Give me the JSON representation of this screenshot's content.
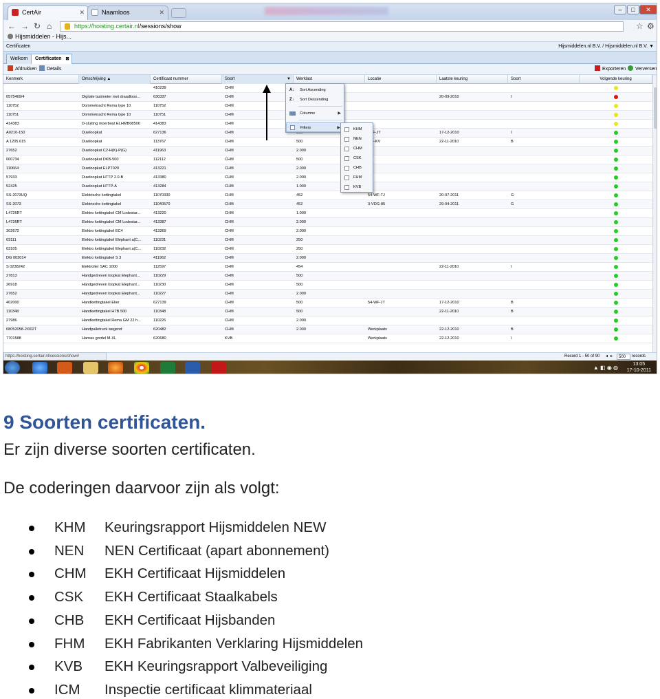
{
  "browser": {
    "tabs": [
      {
        "label": "CertAir"
      },
      {
        "label": "Naamloos"
      }
    ],
    "url_host": "https://hoisting.certair.nl",
    "url_path": "/sessions/show",
    "bookmark": "Hijsmiddelen - Hijs..."
  },
  "app": {
    "section_title": "Certificaten",
    "company": "Hijsmiddelen.nl B.V. / Hijsmiddelen.nl B.V. ▼",
    "tabs": [
      {
        "label": "Welkom"
      },
      {
        "label": "Certificaten"
      }
    ],
    "toolbar": {
      "print": "Afdrukken",
      "details": "Details",
      "export": "Exporteren",
      "refresh": "Verversen"
    }
  },
  "grid": {
    "columns": [
      "Kenmerk",
      "Omschrijving ▲",
      "Certificaat nummer",
      "Soort",
      "Werklast",
      "Locatie",
      "Laatste keuring",
      "Soort",
      "Volgende keuring"
    ],
    "rows": [
      {
        "k": "",
        "o": "",
        "c": "410239",
        "s": "CHM",
        "w": "",
        "l": "",
        "d": "",
        "t": "",
        "st": "yellow"
      },
      {
        "k": "0575469/4",
        "o": "Digitale lastmeter met draadloos...",
        "c": "630337",
        "s": "CHM",
        "w": "",
        "l": "",
        "d": "20-09-2010",
        "t": "I",
        "st": "red"
      },
      {
        "k": "110752",
        "o": "Dommekracht Rema type 10",
        "c": "110752",
        "s": "CHM",
        "w": "",
        "l": "",
        "d": "",
        "t": "",
        "st": "yellow"
      },
      {
        "k": "110751",
        "o": "Dommekracht Rema type 10",
        "c": "110751",
        "s": "CHM",
        "w": "",
        "l": "",
        "d": "",
        "t": "",
        "st": "yellow"
      },
      {
        "k": "414383",
        "o": "D-sluiting moerbout ELHMB08500",
        "c": "414383",
        "s": "CHM",
        "w": "",
        "l": "",
        "d": "",
        "t": "",
        "st": "yellow"
      },
      {
        "k": "A0210-150",
        "o": "Duwloopkat",
        "c": "627136",
        "s": "CHM",
        "w": "500",
        "l": "-WF-JT",
        "d": "17-12-2010",
        "t": "I",
        "st": "green"
      },
      {
        "k": "A 1205.615",
        "o": "Duwloopkat",
        "c": "113767",
        "s": "CHM",
        "w": "500",
        "l": "-BF-KV",
        "d": "22-11-2010",
        "t": "B",
        "st": "green"
      },
      {
        "k": "27652",
        "o": "Duwloopkat C2-H(K)-P(G)",
        "c": "411963",
        "s": "CHM",
        "w": "2.000",
        "l": "",
        "d": "",
        "t": "",
        "st": "green"
      },
      {
        "k": "000734",
        "o": "Duwloopkat DKB-500",
        "c": "112112",
        "s": "CHM",
        "w": "500",
        "l": "",
        "d": "",
        "t": "",
        "st": "green"
      },
      {
        "k": "110664",
        "o": "Duwloopkat ELPT020",
        "c": "413221",
        "s": "CHM",
        "w": "2.000",
        "l": "",
        "d": "",
        "t": "",
        "st": "green"
      },
      {
        "k": "57933",
        "o": "Duwloopkat HTTP 2.0-B",
        "c": "413380",
        "s": "CHM",
        "w": "2.000",
        "l": "",
        "d": "",
        "t": "",
        "st": "green"
      },
      {
        "k": "52425",
        "o": "Duwloopkat HTTP-A",
        "c": "413284",
        "s": "CHM",
        "w": "1.000",
        "l": "",
        "d": "",
        "t": "",
        "st": "green"
      },
      {
        "k": "SS-2073UQ",
        "o": "Elektrische kettingtakel",
        "c": "11070330",
        "s": "CHM",
        "w": "452",
        "l": "54-WF-TJ",
        "d": "20-07-2011",
        "t": "G",
        "st": "green"
      },
      {
        "k": "SS-2073",
        "o": "Elektrische kettingtakel",
        "c": "11040570",
        "s": "CHM",
        "w": "452",
        "l": "3-VDG-85",
        "d": "29-04-2011",
        "t": "G",
        "st": "green"
      },
      {
        "k": "L4726RT",
        "o": "Elektro kettingtakel CM Lodestar...",
        "c": "413220",
        "s": "CHM",
        "w": "1.000",
        "l": "",
        "d": "",
        "t": "",
        "st": "green"
      },
      {
        "k": "L4726RT",
        "o": "Elektro kettingtakel CM Lodestar...",
        "c": "413387",
        "s": "CHM",
        "w": "2.000",
        "l": "",
        "d": "",
        "t": "",
        "st": "green"
      },
      {
        "k": "302672",
        "o": "Elektro kettingtakel EC4",
        "c": "413369",
        "s": "CHM",
        "w": "2.000",
        "l": "",
        "d": "",
        "t": "",
        "st": "green"
      },
      {
        "k": "03111",
        "o": "Elektro kettingtakel Elephant a(C...",
        "c": "110231",
        "s": "CHM",
        "w": "250",
        "l": "",
        "d": "",
        "t": "",
        "st": "green"
      },
      {
        "k": "03105",
        "o": "Elektro kettingtakel Elephant a(C...",
        "c": "110232",
        "s": "CHM",
        "w": "250",
        "l": "",
        "d": "",
        "t": "",
        "st": "green"
      },
      {
        "k": "DG 003014",
        "o": "Elektro kettingtakel S 3",
        "c": "411962",
        "s": "CHM",
        "w": "2.000",
        "l": "",
        "d": "",
        "t": "",
        "st": "green"
      },
      {
        "k": "S 0238242",
        "o": "Elektrolier SAC 1000",
        "c": "112597",
        "s": "CHM",
        "w": "454",
        "l": "",
        "d": "22-11-2010",
        "t": "I",
        "st": "green"
      },
      {
        "k": "27813",
        "o": "Handgedreven loopkat Elephant...",
        "c": "110229",
        "s": "CHM",
        "w": "500",
        "l": "",
        "d": "",
        "t": "",
        "st": "green"
      },
      {
        "k": "26918",
        "o": "Handgedreven loopkat Elephant...",
        "c": "110230",
        "s": "CHM",
        "w": "500",
        "l": "",
        "d": "",
        "t": "",
        "st": "green"
      },
      {
        "k": "27652",
        "o": "Handgedreven loopkat Elephant...",
        "c": "110227",
        "s": "CHM",
        "w": "2.000",
        "l": "",
        "d": "",
        "t": "",
        "st": "green"
      },
      {
        "k": "402000",
        "o": "Handkettingtakel Elier",
        "c": "627139",
        "s": "CHM",
        "w": "500",
        "l": "54-WF-JT",
        "d": "17-12-2010",
        "t": "B",
        "st": "green"
      },
      {
        "k": "110348",
        "o": "Handkettingtakel HTB 500",
        "c": "110348",
        "s": "CHM",
        "w": "500",
        "l": "",
        "d": "22-11-2010",
        "t": "B",
        "st": "green"
      },
      {
        "k": "27986",
        "o": "Handkettingtakel Rema GM 22 h...",
        "c": "110226",
        "s": "CHM",
        "w": "2.000",
        "l": "",
        "d": "",
        "t": "",
        "st": "green"
      },
      {
        "k": "08052058-2/002T",
        "o": "Handpalletruck wegend",
        "c": "620482",
        "s": "CHM",
        "w": "2.000",
        "l": "Werkplaats",
        "d": "22-12-2010",
        "t": "B",
        "st": "green"
      },
      {
        "k": "7701588",
        "o": "Harnas gordel M-XL",
        "c": "620680",
        "s": "KVB",
        "w": "",
        "l": "Werkplaats",
        "d": "22-12-2010",
        "t": "I",
        "st": "green"
      }
    ]
  },
  "menu": {
    "items": [
      "Sort Ascending",
      "Sort Descending",
      "Columns",
      "Filters"
    ],
    "filters": [
      "KHM",
      "NEN",
      "CHM",
      "CSK",
      "CHB",
      "FHM",
      "KVB"
    ]
  },
  "pager": {
    "record": "Record 1 - 50 of 90",
    "page_size": "500",
    "records": "records",
    "status_url": "https://hoisting.certair.nl/sessions/show#"
  },
  "taskbar": {
    "time": "13:05",
    "date": "17-10-2011"
  },
  "colors": {
    "heading": "#2f5596",
    "green": "#22cc22",
    "yellow": "#e6e619",
    "red": "#dd1111"
  },
  "doc": {
    "heading": "9 Soorten certificaten.",
    "intro": "Er zijn diverse soorten certificaten.",
    "lead": "De coderingen daarvoor zijn als volgt:",
    "items": [
      {
        "code": "KHM",
        "desc": "Keuringsrapport Hijsmiddelen NEW"
      },
      {
        "code": "NEN",
        "desc": "NEN Certificaat (apart abonnement)"
      },
      {
        "code": "CHM",
        "desc": "EKH Certificaat Hijsmiddelen"
      },
      {
        "code": "CSK",
        "desc": "EKH Certificaat Staalkabels"
      },
      {
        "code": "CHB",
        "desc": "EKH Certificaat Hijsbanden"
      },
      {
        "code": "FHM",
        "desc": "EKH Fabrikanten Verklaring Hijsmiddelen"
      },
      {
        "code": "KVB",
        "desc": "EKH Keuringsrapport Valbeveiliging"
      },
      {
        "code": "ICM",
        "desc": "Inspectie certificaat klimmateriaal"
      }
    ]
  }
}
